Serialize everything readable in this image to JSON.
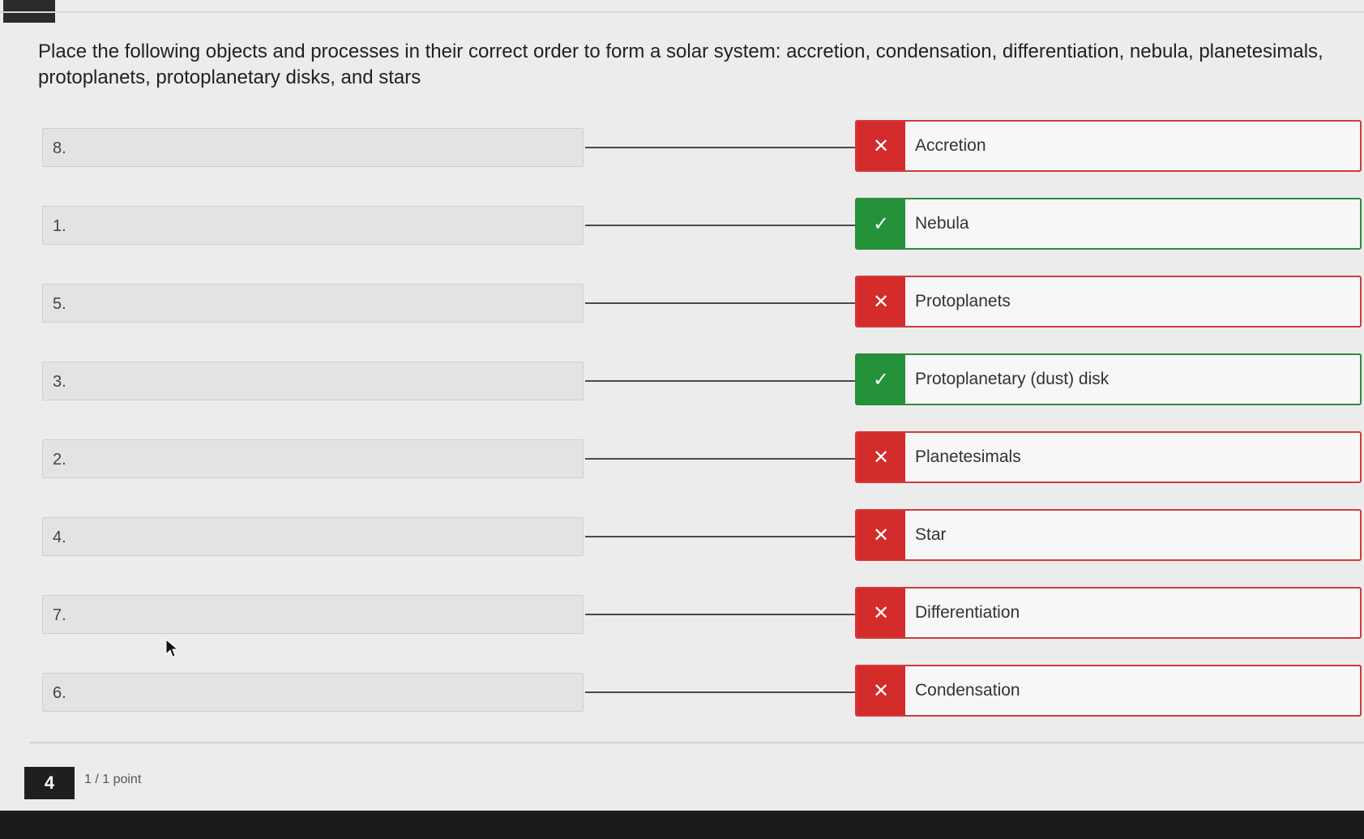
{
  "question": {
    "text": "Place the following objects and processes in their correct order to form a solar system: accretion, condensation, differentiation, nebula, planetesimals, protoplanets, protoplanetary disks, and stars"
  },
  "rows": [
    {
      "slot": "8.",
      "answer": "Accretion",
      "status": "incorrect",
      "status_icon": "✕"
    },
    {
      "slot": "1.",
      "answer": "Nebula",
      "status": "correct",
      "status_icon": "✓"
    },
    {
      "slot": "5.",
      "answer": "Protoplanets",
      "status": "incorrect",
      "status_icon": "✕"
    },
    {
      "slot": "3.",
      "answer": "Protoplanetary (dust) disk",
      "status": "correct",
      "status_icon": "✓"
    },
    {
      "slot": "2.",
      "answer": "Planetesimals",
      "status": "incorrect",
      "status_icon": "✕"
    },
    {
      "slot": "4.",
      "answer": "Star",
      "status": "incorrect",
      "status_icon": "✕"
    },
    {
      "slot": "7.",
      "answer": "Differentiation",
      "status": "incorrect",
      "status_icon": "✕"
    },
    {
      "slot": "6.",
      "answer": "Condensation",
      "status": "incorrect",
      "status_icon": "✕"
    }
  ],
  "footer": {
    "question_number": "4",
    "score": "1 / 1 point"
  },
  "colors": {
    "correct": "#23923a",
    "incorrect": "#d42b2b"
  }
}
